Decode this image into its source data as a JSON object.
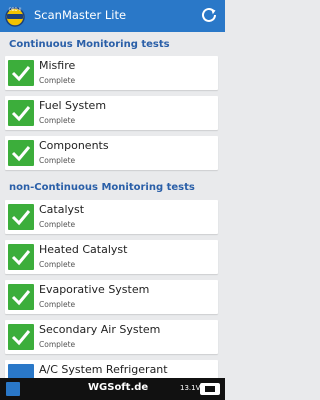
{
  "appbar": {
    "title": "ScanMaster Lite",
    "logo_text": "OBD-II",
    "icons": {
      "logo": "obd-logo-icon",
      "refresh": "refresh-icon"
    },
    "colors": {
      "background": "#2a78c8"
    }
  },
  "sections": [
    {
      "header": "Continuous Monitoring tests"
    },
    {
      "header": "non-Continuous Monitoring tests"
    }
  ],
  "tests": [
    {
      "title": "Misfire",
      "status": "Complete"
    },
    {
      "title": "Fuel System",
      "status": "Complete"
    },
    {
      "title": "Components",
      "status": "Complete"
    },
    {
      "title": "Catalyst",
      "status": "Complete"
    },
    {
      "title": "Heated Catalyst",
      "status": "Complete"
    },
    {
      "title": "Evaporative System",
      "status": "Complete"
    },
    {
      "title": "Secondary Air System",
      "status": "Complete"
    },
    {
      "title": "A/C System Refrigerant",
      "status": ""
    }
  ],
  "colors": {
    "complete": "#3cae3b",
    "section_header": "#2a5fa8"
  },
  "statusbar": {
    "brand": "WGSoft.de",
    "voltage": "13.1V"
  }
}
